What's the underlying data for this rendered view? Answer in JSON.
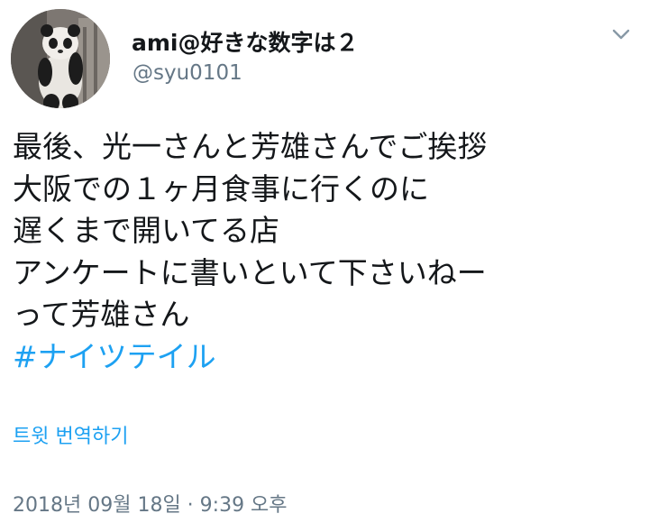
{
  "author": {
    "display_name": "ami@好きな数字は２",
    "handle": "@syu0101",
    "avatar_icon": "panda-avatar"
  },
  "menu": {
    "icon": "chevron-down-icon"
  },
  "tweet": {
    "lines": [
      "最後、光一さんと芳雄さんでご挨拶",
      "大阪での１ヶ月食事に行くのに",
      "遅くまで開いてる店",
      "アンケートに書いといて下さいねー",
      "って芳雄さん"
    ],
    "hashtag": "#ナイツテイル"
  },
  "translate_label": "트윗 번역하기",
  "timestamp": "2018년 09월 18일 · 9:39 오후",
  "colors": {
    "link": "#1da1f2",
    "secondary_text": "#657786",
    "primary_text": "#14171a"
  }
}
